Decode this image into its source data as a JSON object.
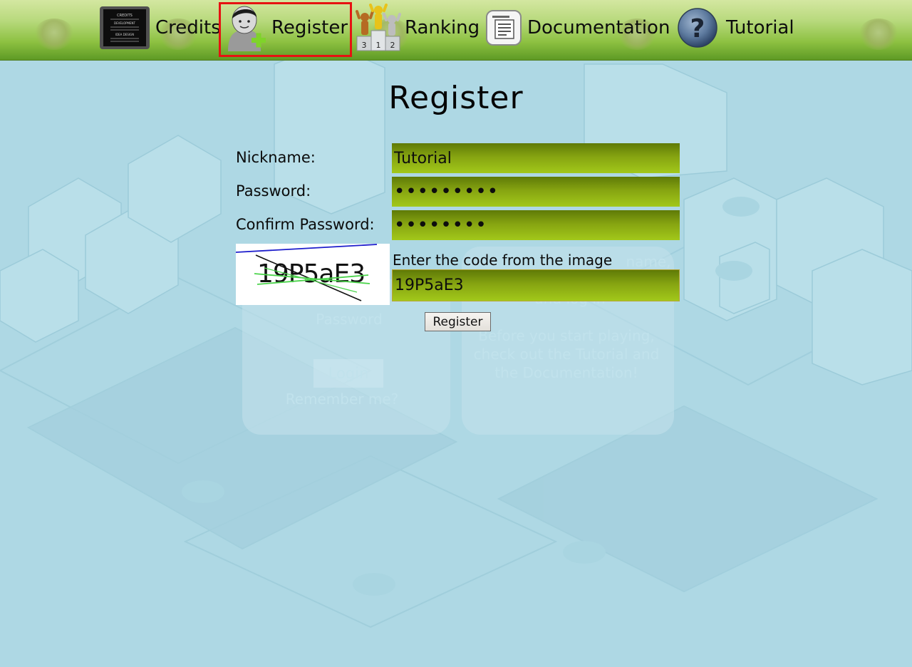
{
  "nav": {
    "items": [
      {
        "label": "Credits",
        "icon": "credits-board-icon"
      },
      {
        "label": "Register",
        "icon": "add-user-icon",
        "active": true
      },
      {
        "label": "Ranking",
        "icon": "podium-icon"
      },
      {
        "label": "Documentation",
        "icon": "document-icon"
      },
      {
        "label": "Tutorial",
        "icon": "question-mark-icon"
      }
    ],
    "credits_icon_lines": [
      "CREDITS",
      "DEVELOPMENT",
      "IDEA DESIGN"
    ],
    "podium_ranks": [
      "3",
      "1",
      "2"
    ],
    "highlight_color": "#e61212"
  },
  "register": {
    "title": "Register",
    "nickname": {
      "label": "Nickname:",
      "value": "Tutorial"
    },
    "password": {
      "label": "Password:",
      "value": "•••••••••"
    },
    "confirm_password": {
      "label": "Confirm Password:",
      "value": "••••••••"
    },
    "captcha": {
      "image_text": "19P5aE3",
      "hint": "Enter the code from the image",
      "value": "19P5aE3"
    },
    "submit_label": "Register"
  },
  "background_login": {
    "password_label": "Password",
    "login_button": "Login",
    "remember_label": "Remember me?",
    "info_lines": [
      "name,",
      "and log in",
      "Before you start playing,",
      "check out the Tutorial and",
      "the Documentation!"
    ]
  },
  "colors": {
    "background": "#aed8e4",
    "input_fill": "#86a411",
    "topbar": "#8dc141"
  }
}
